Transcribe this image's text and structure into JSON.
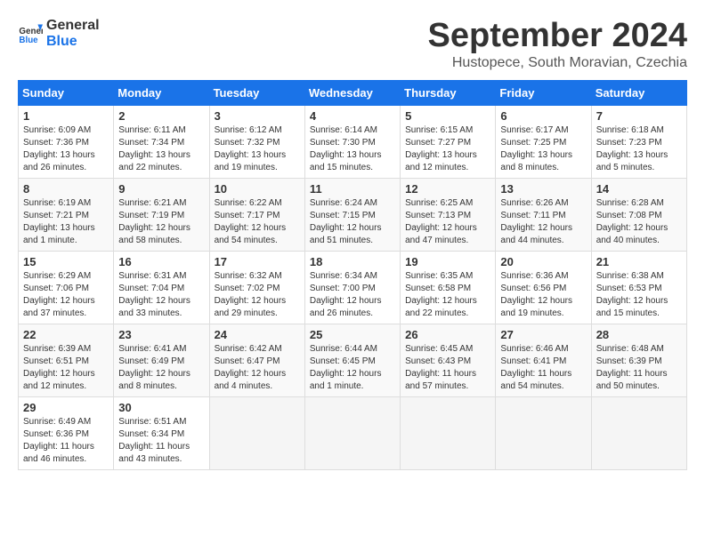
{
  "logo": {
    "line1": "General",
    "line2": "Blue"
  },
  "title": "September 2024",
  "subtitle": "Hustopece, South Moravian, Czechia",
  "weekdays": [
    "Sunday",
    "Monday",
    "Tuesday",
    "Wednesday",
    "Thursday",
    "Friday",
    "Saturday"
  ],
  "weeks": [
    [
      {
        "day": "1",
        "sunrise": "Sunrise: 6:09 AM",
        "sunset": "Sunset: 7:36 PM",
        "daylight": "Daylight: 13 hours and 26 minutes."
      },
      {
        "day": "2",
        "sunrise": "Sunrise: 6:11 AM",
        "sunset": "Sunset: 7:34 PM",
        "daylight": "Daylight: 13 hours and 22 minutes."
      },
      {
        "day": "3",
        "sunrise": "Sunrise: 6:12 AM",
        "sunset": "Sunset: 7:32 PM",
        "daylight": "Daylight: 13 hours and 19 minutes."
      },
      {
        "day": "4",
        "sunrise": "Sunrise: 6:14 AM",
        "sunset": "Sunset: 7:30 PM",
        "daylight": "Daylight: 13 hours and 15 minutes."
      },
      {
        "day": "5",
        "sunrise": "Sunrise: 6:15 AM",
        "sunset": "Sunset: 7:27 PM",
        "daylight": "Daylight: 13 hours and 12 minutes."
      },
      {
        "day": "6",
        "sunrise": "Sunrise: 6:17 AM",
        "sunset": "Sunset: 7:25 PM",
        "daylight": "Daylight: 13 hours and 8 minutes."
      },
      {
        "day": "7",
        "sunrise": "Sunrise: 6:18 AM",
        "sunset": "Sunset: 7:23 PM",
        "daylight": "Daylight: 13 hours and 5 minutes."
      }
    ],
    [
      {
        "day": "8",
        "sunrise": "Sunrise: 6:19 AM",
        "sunset": "Sunset: 7:21 PM",
        "daylight": "Daylight: 13 hours and 1 minute."
      },
      {
        "day": "9",
        "sunrise": "Sunrise: 6:21 AM",
        "sunset": "Sunset: 7:19 PM",
        "daylight": "Daylight: 12 hours and 58 minutes."
      },
      {
        "day": "10",
        "sunrise": "Sunrise: 6:22 AM",
        "sunset": "Sunset: 7:17 PM",
        "daylight": "Daylight: 12 hours and 54 minutes."
      },
      {
        "day": "11",
        "sunrise": "Sunrise: 6:24 AM",
        "sunset": "Sunset: 7:15 PM",
        "daylight": "Daylight: 12 hours and 51 minutes."
      },
      {
        "day": "12",
        "sunrise": "Sunrise: 6:25 AM",
        "sunset": "Sunset: 7:13 PM",
        "daylight": "Daylight: 12 hours and 47 minutes."
      },
      {
        "day": "13",
        "sunrise": "Sunrise: 6:26 AM",
        "sunset": "Sunset: 7:11 PM",
        "daylight": "Daylight: 12 hours and 44 minutes."
      },
      {
        "day": "14",
        "sunrise": "Sunrise: 6:28 AM",
        "sunset": "Sunset: 7:08 PM",
        "daylight": "Daylight: 12 hours and 40 minutes."
      }
    ],
    [
      {
        "day": "15",
        "sunrise": "Sunrise: 6:29 AM",
        "sunset": "Sunset: 7:06 PM",
        "daylight": "Daylight: 12 hours and 37 minutes."
      },
      {
        "day": "16",
        "sunrise": "Sunrise: 6:31 AM",
        "sunset": "Sunset: 7:04 PM",
        "daylight": "Daylight: 12 hours and 33 minutes."
      },
      {
        "day": "17",
        "sunrise": "Sunrise: 6:32 AM",
        "sunset": "Sunset: 7:02 PM",
        "daylight": "Daylight: 12 hours and 29 minutes."
      },
      {
        "day": "18",
        "sunrise": "Sunrise: 6:34 AM",
        "sunset": "Sunset: 7:00 PM",
        "daylight": "Daylight: 12 hours and 26 minutes."
      },
      {
        "day": "19",
        "sunrise": "Sunrise: 6:35 AM",
        "sunset": "Sunset: 6:58 PM",
        "daylight": "Daylight: 12 hours and 22 minutes."
      },
      {
        "day": "20",
        "sunrise": "Sunrise: 6:36 AM",
        "sunset": "Sunset: 6:56 PM",
        "daylight": "Daylight: 12 hours and 19 minutes."
      },
      {
        "day": "21",
        "sunrise": "Sunrise: 6:38 AM",
        "sunset": "Sunset: 6:53 PM",
        "daylight": "Daylight: 12 hours and 15 minutes."
      }
    ],
    [
      {
        "day": "22",
        "sunrise": "Sunrise: 6:39 AM",
        "sunset": "Sunset: 6:51 PM",
        "daylight": "Daylight: 12 hours and 12 minutes."
      },
      {
        "day": "23",
        "sunrise": "Sunrise: 6:41 AM",
        "sunset": "Sunset: 6:49 PM",
        "daylight": "Daylight: 12 hours and 8 minutes."
      },
      {
        "day": "24",
        "sunrise": "Sunrise: 6:42 AM",
        "sunset": "Sunset: 6:47 PM",
        "daylight": "Daylight: 12 hours and 4 minutes."
      },
      {
        "day": "25",
        "sunrise": "Sunrise: 6:44 AM",
        "sunset": "Sunset: 6:45 PM",
        "daylight": "Daylight: 12 hours and 1 minute."
      },
      {
        "day": "26",
        "sunrise": "Sunrise: 6:45 AM",
        "sunset": "Sunset: 6:43 PM",
        "daylight": "Daylight: 11 hours and 57 minutes."
      },
      {
        "day": "27",
        "sunrise": "Sunrise: 6:46 AM",
        "sunset": "Sunset: 6:41 PM",
        "daylight": "Daylight: 11 hours and 54 minutes."
      },
      {
        "day": "28",
        "sunrise": "Sunrise: 6:48 AM",
        "sunset": "Sunset: 6:39 PM",
        "daylight": "Daylight: 11 hours and 50 minutes."
      }
    ],
    [
      {
        "day": "29",
        "sunrise": "Sunrise: 6:49 AM",
        "sunset": "Sunset: 6:36 PM",
        "daylight": "Daylight: 11 hours and 46 minutes."
      },
      {
        "day": "30",
        "sunrise": "Sunrise: 6:51 AM",
        "sunset": "Sunset: 6:34 PM",
        "daylight": "Daylight: 11 hours and 43 minutes."
      },
      null,
      null,
      null,
      null,
      null
    ]
  ]
}
